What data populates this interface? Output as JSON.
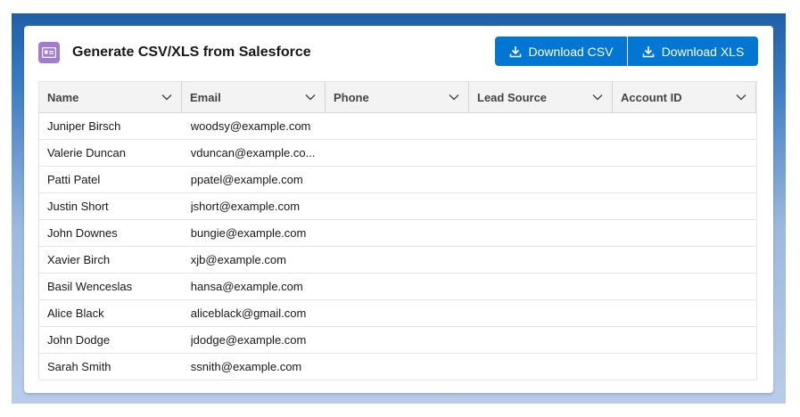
{
  "header": {
    "title": "Generate CSV/XLS from Salesforce",
    "icon": "contact-card-icon",
    "icon_color": "#a27bd9"
  },
  "buttons": {
    "download_csv": "Download CSV",
    "download_xls": "Download XLS",
    "color": "#0176d3"
  },
  "table": {
    "columns": [
      "Name",
      "Email",
      "Phone",
      "Lead Source",
      "Account ID"
    ],
    "rows": [
      {
        "name": "Juniper Birsch",
        "email": "woodsy@example.com",
        "phone": "",
        "lead_source": "",
        "account_id": ""
      },
      {
        "name": "Valerie Duncan",
        "email": "vduncan@example.co...",
        "phone": "",
        "lead_source": "",
        "account_id": ""
      },
      {
        "name": "Patti Patel",
        "email": "ppatel@example.com",
        "phone": "",
        "lead_source": "",
        "account_id": ""
      },
      {
        "name": "Justin Short",
        "email": "jshort@example.com",
        "phone": "",
        "lead_source": "",
        "account_id": ""
      },
      {
        "name": "John Downes",
        "email": "bungie@example.com",
        "phone": "",
        "lead_source": "",
        "account_id": ""
      },
      {
        "name": "Xavier Birch",
        "email": "xjb@example.com",
        "phone": "",
        "lead_source": "",
        "account_id": ""
      },
      {
        "name": "Basil Wenceslas",
        "email": "hansa@example.com",
        "phone": "",
        "lead_source": "",
        "account_id": ""
      },
      {
        "name": "Alice Black",
        "email": "aliceblack@gmail.com",
        "phone": "",
        "lead_source": "",
        "account_id": ""
      },
      {
        "name": "John Dodge",
        "email": "jdodge@example.com",
        "phone": "",
        "lead_source": "",
        "account_id": ""
      },
      {
        "name": "Sarah Smith",
        "email": "ssnith@example.com",
        "phone": "",
        "lead_source": "",
        "account_id": ""
      }
    ]
  }
}
